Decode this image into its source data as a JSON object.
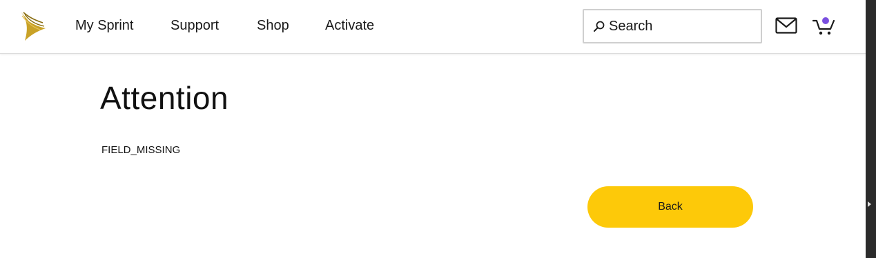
{
  "header": {
    "logo_name": "sprint-logo",
    "nav": [
      {
        "label": "My Sprint"
      },
      {
        "label": "Support"
      },
      {
        "label": "Shop"
      },
      {
        "label": "Activate"
      }
    ],
    "search": {
      "placeholder": "Search",
      "value": ""
    },
    "icons": {
      "mail": "mail-icon",
      "cart": "cart-icon"
    },
    "cart_badge_color": "#7a4fe0"
  },
  "main": {
    "title": "Attention",
    "message": "FIELD_MISSING",
    "back_label": "Back"
  },
  "colors": {
    "accent": "#fdc909",
    "logo": "#c9a227"
  }
}
